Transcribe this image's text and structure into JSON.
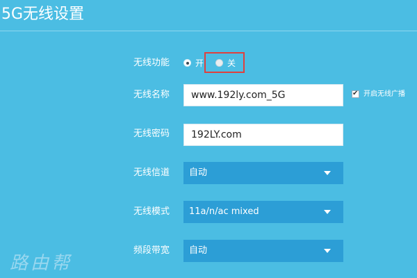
{
  "page": {
    "title": "5G无线设置"
  },
  "form": {
    "wireless_function": {
      "label": "无线功能",
      "options": [
        {
          "label": "开",
          "selected": true
        },
        {
          "label": "关",
          "selected": false
        }
      ]
    },
    "wireless_name": {
      "label": "无线名称",
      "value": "www.192ly.com_5G",
      "broadcast_label": "开启无线广播",
      "broadcast_checked": true
    },
    "wireless_password": {
      "label": "无线密码",
      "value": "192LY.com"
    },
    "wireless_channel": {
      "label": "无线信道",
      "value": "自动"
    },
    "wireless_mode": {
      "label": "无线模式",
      "value": "11a/n/ac mixed"
    },
    "bandwidth": {
      "label": "频段带宽",
      "value": "自动"
    }
  },
  "watermark": "路由帮",
  "colors": {
    "background": "#4bbde3",
    "select_background": "#2c9ed6",
    "highlight_border": "#e0403d"
  }
}
